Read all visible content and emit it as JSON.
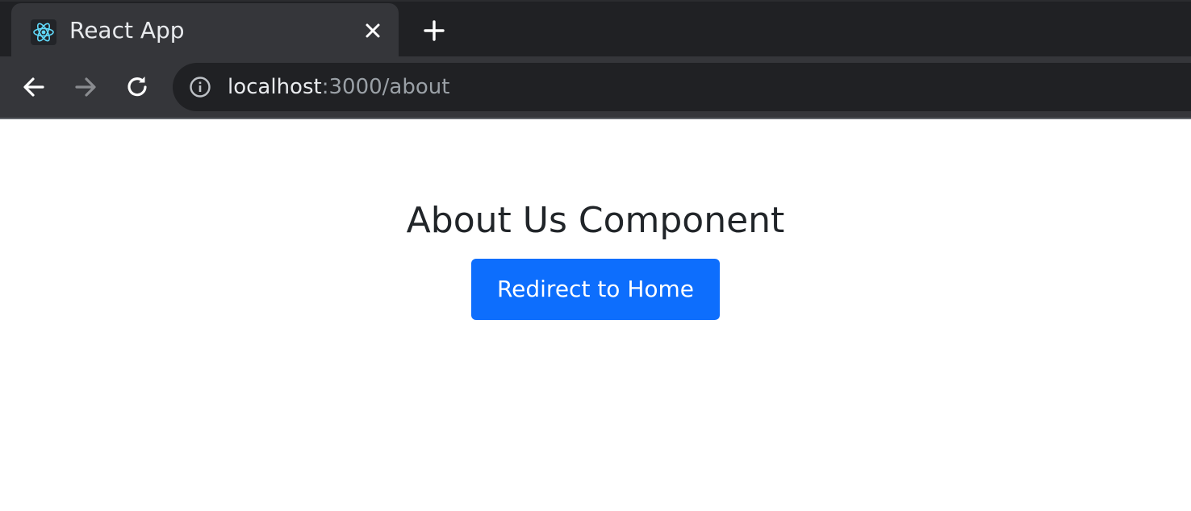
{
  "browser": {
    "tab": {
      "title": "React App",
      "favicon": "react-logo-icon",
      "close_icon": "close-icon"
    },
    "new_tab_icon": "plus-icon",
    "nav": {
      "back_icon": "arrow-left-icon",
      "forward_icon": "arrow-right-icon",
      "reload_icon": "reload-icon"
    },
    "address_bar": {
      "info_icon": "info-icon",
      "host": "localhost",
      "rest": ":3000/about"
    }
  },
  "page": {
    "heading": "About Us Component",
    "redirect_button_label": "Redirect to Home"
  },
  "colors": {
    "tabstrip_bg": "#202124",
    "toolbar_bg": "#35363a",
    "button_primary": "#0d6efd",
    "heading_text": "#212529"
  }
}
